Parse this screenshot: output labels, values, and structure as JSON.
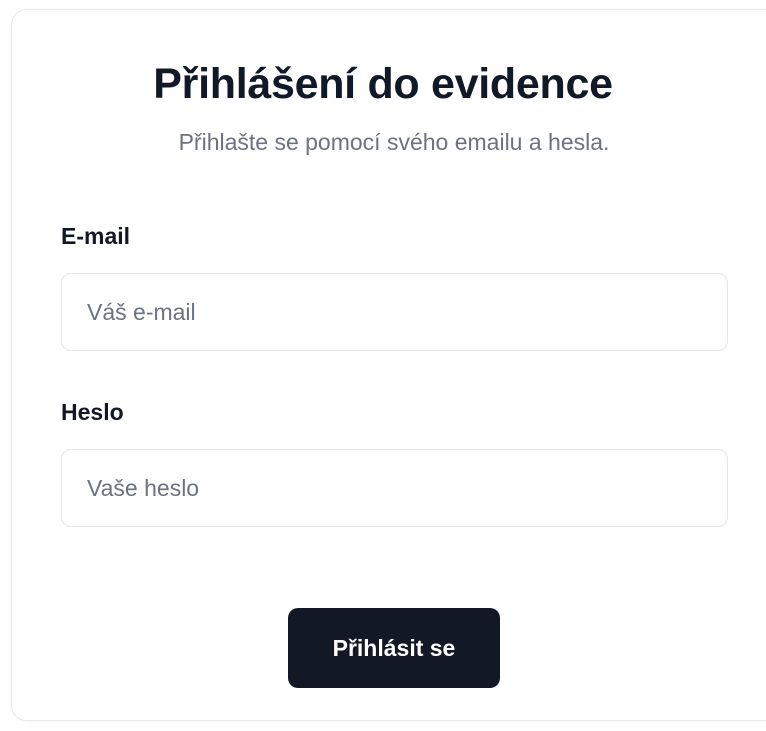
{
  "login": {
    "title": "Přihlášení do evidence",
    "subtitle": "Přihlašte se pomocí svého emailu a hesla.",
    "email": {
      "label": "E-mail",
      "value": "",
      "placeholder": "Váš e-mail"
    },
    "password": {
      "label": "Heslo",
      "value": "",
      "placeholder": "Vaše heslo"
    },
    "submit_label": "Přihlásit se"
  },
  "colors": {
    "button_background": "#121826",
    "title_text": "#111827",
    "muted_text": "#6b7280",
    "border": "#e5e7eb"
  }
}
